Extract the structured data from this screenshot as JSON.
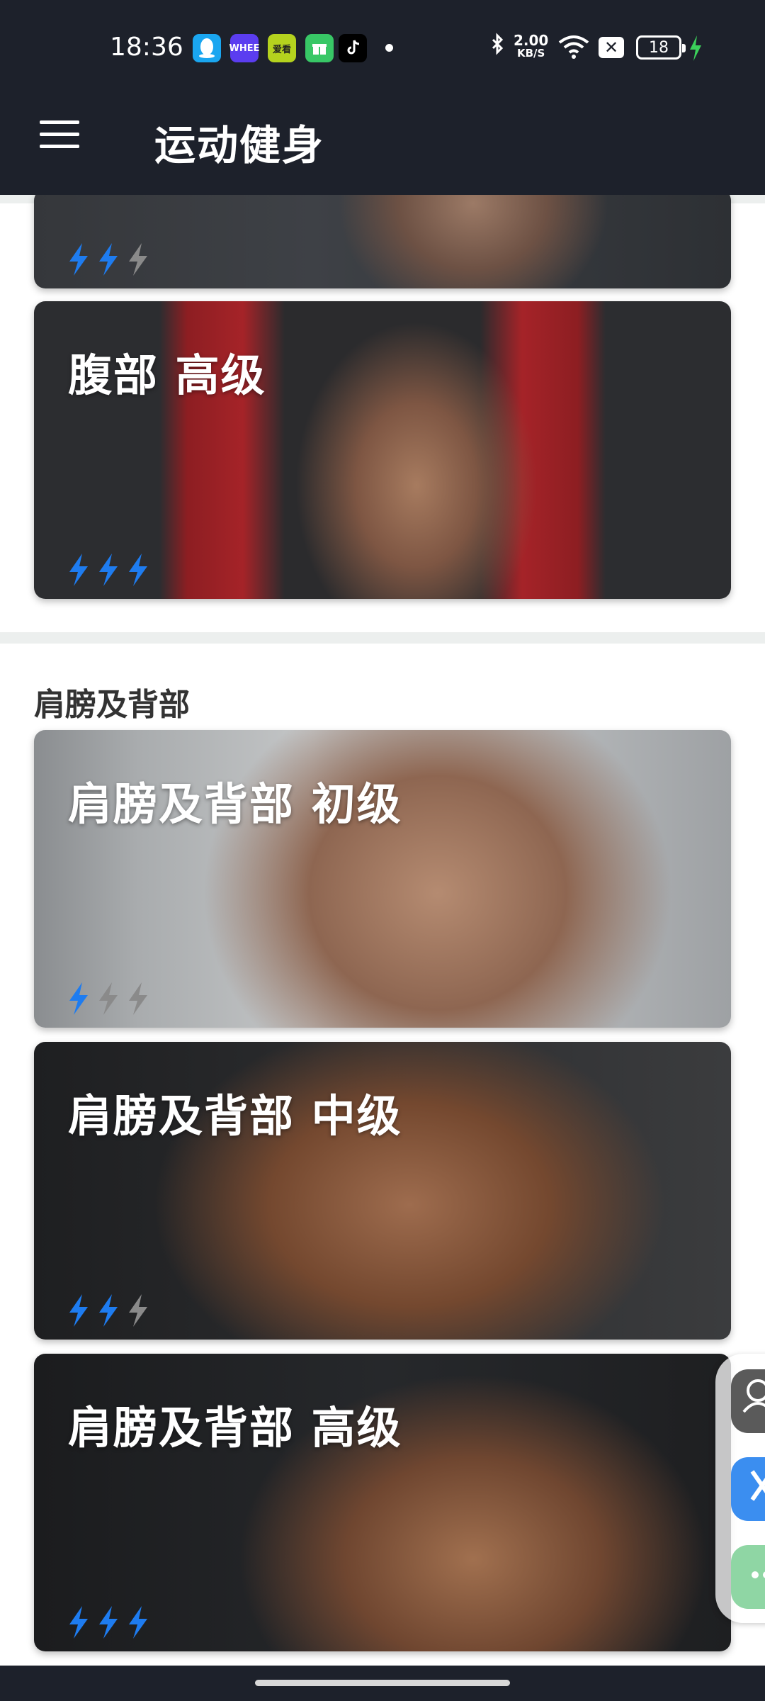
{
  "status_bar": {
    "time": "18:36",
    "speed_value": "2.00",
    "speed_unit": "KB/S",
    "battery": "18",
    "apps": [
      {
        "icon": "qq-icon",
        "color": "#1aa6f0",
        "label": ""
      },
      {
        "icon": "whee-icon",
        "color": "#5b3df0",
        "label": "WHEE"
      },
      {
        "icon": "aiqiyi-icon",
        "color": "#b5d21e",
        "label": "爱看"
      },
      {
        "icon": "gift-icon",
        "color": "#38c766",
        "label": ""
      },
      {
        "icon": "tiktok-icon",
        "color": "#000000",
        "label": ""
      }
    ]
  },
  "header": {
    "title": "运动健身",
    "menu_icon": "menu-icon"
  },
  "section_abs": {
    "cards": [
      {
        "label": "",
        "level": 2,
        "max": 3
      },
      {
        "label": "腹部 高级",
        "level": 3,
        "max": 3
      }
    ]
  },
  "section_shoulder_back": {
    "title": "肩膀及背部",
    "cards": [
      {
        "label": "肩膀及背部 初级",
        "level": 1,
        "max": 3
      },
      {
        "label": "肩膀及背部 中级",
        "level": 2,
        "max": 3
      },
      {
        "label": "肩膀及背部 高级",
        "level": 3,
        "max": 3
      }
    ]
  },
  "colors": {
    "topbar": "#1d212b",
    "bolt_active": "#1e7cf0",
    "bolt_inactive": "#8a8a8a",
    "float_gray": "#5a5a5a",
    "float_blue": "#3b8ef0",
    "float_green": "#8fd6a4"
  }
}
